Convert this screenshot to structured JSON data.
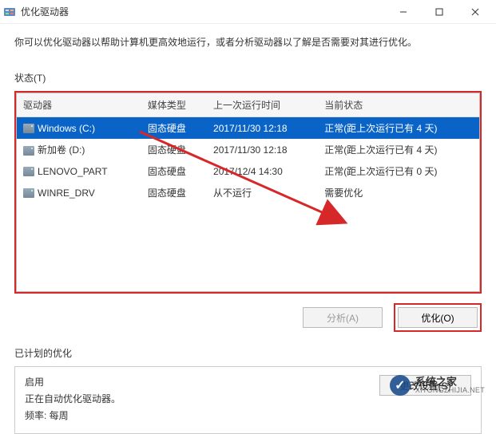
{
  "titlebar": {
    "icon": "defrag-icon",
    "title": "优化驱动器"
  },
  "description": "你可以优化驱动器以帮助计算机更高效地运行，或者分析驱动器以了解是否需要对其进行优化。",
  "status_label": "状态(T)",
  "columns": {
    "drive": "驱动器",
    "media": "媒体类型",
    "last_run": "上一次运行时间",
    "status": "当前状态"
  },
  "drives": [
    {
      "name": "Windows (C:)",
      "media": "固态硬盘",
      "last_run": "2017/11/30 12:18",
      "status": "正常(距上次运行已有 4 天)",
      "selected": true
    },
    {
      "name": "新加卷 (D:)",
      "media": "固态硬盘",
      "last_run": "2017/11/30 12:18",
      "status": "正常(距上次运行已有 4 天)",
      "selected": false
    },
    {
      "name": "LENOVO_PART",
      "media": "固态硬盘",
      "last_run": "2017/12/4 14:30",
      "status": "正常(距上次运行已有 0 天)",
      "selected": false
    },
    {
      "name": "WINRE_DRV",
      "media": "固态硬盘",
      "last_run": "从不运行",
      "status": "需要优化",
      "selected": false
    }
  ],
  "buttons": {
    "analyze": "分析(A)",
    "optimize": "优化(O)"
  },
  "schedule": {
    "label": "已计划的优化",
    "enabled_title": "启用",
    "enabled_desc": "正在自动优化驱动器。",
    "frequency": "频率: 每周",
    "change": "更改设置(S)"
  },
  "watermark": {
    "cn": "系统之家",
    "en": "XITONGZHIJIA.NET"
  }
}
